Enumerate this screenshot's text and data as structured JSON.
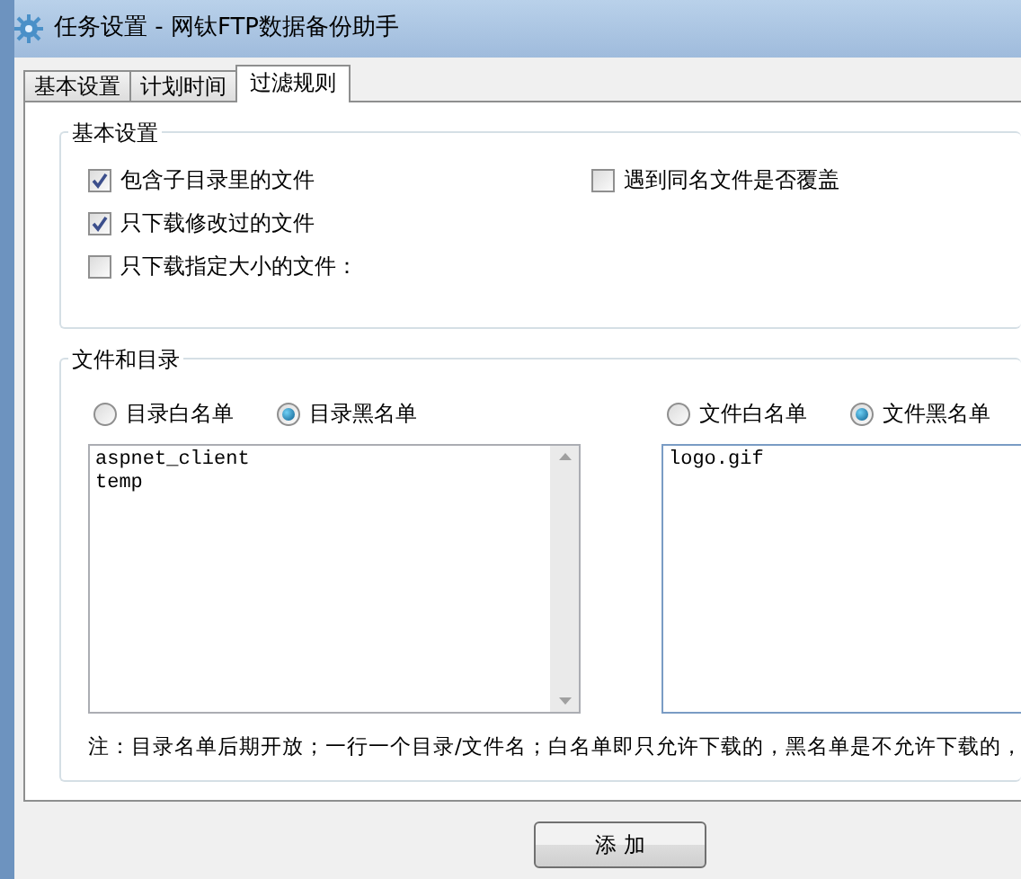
{
  "window": {
    "title": "任务设置 - 网钛FTP数据备份助手"
  },
  "tabs": [
    {
      "label": "基本设置",
      "selected": false
    },
    {
      "label": "计划时间",
      "selected": false
    },
    {
      "label": "过滤规则",
      "selected": true
    }
  ],
  "basic_group": {
    "title": "基本设置",
    "left_options": [
      {
        "label": "包含子目录里的文件",
        "checked": true
      },
      {
        "label": "只下载修改过的文件",
        "checked": true
      },
      {
        "label": "只下载指定大小的文件：",
        "checked": false
      }
    ],
    "right_options": [
      {
        "label": "遇到同名文件是否覆盖",
        "checked": false
      }
    ]
  },
  "files_group": {
    "title": "文件和目录",
    "dir_modes": [
      {
        "label": "目录白名单",
        "selected": false
      },
      {
        "label": "目录黑名单",
        "selected": true
      }
    ],
    "dir_list": "aspnet_client\ntemp",
    "file_modes": [
      {
        "label": "文件白名单",
        "selected": false
      },
      {
        "label": "文件黑名单",
        "selected": true
      }
    ],
    "file_list": "logo.gif",
    "note": "注：目录名单后期开放；一行一个目录/文件名；白名单即只允许下载的，黑名单是不允许下载的，"
  },
  "buttons": [
    {
      "label": "添 加"
    }
  ]
}
